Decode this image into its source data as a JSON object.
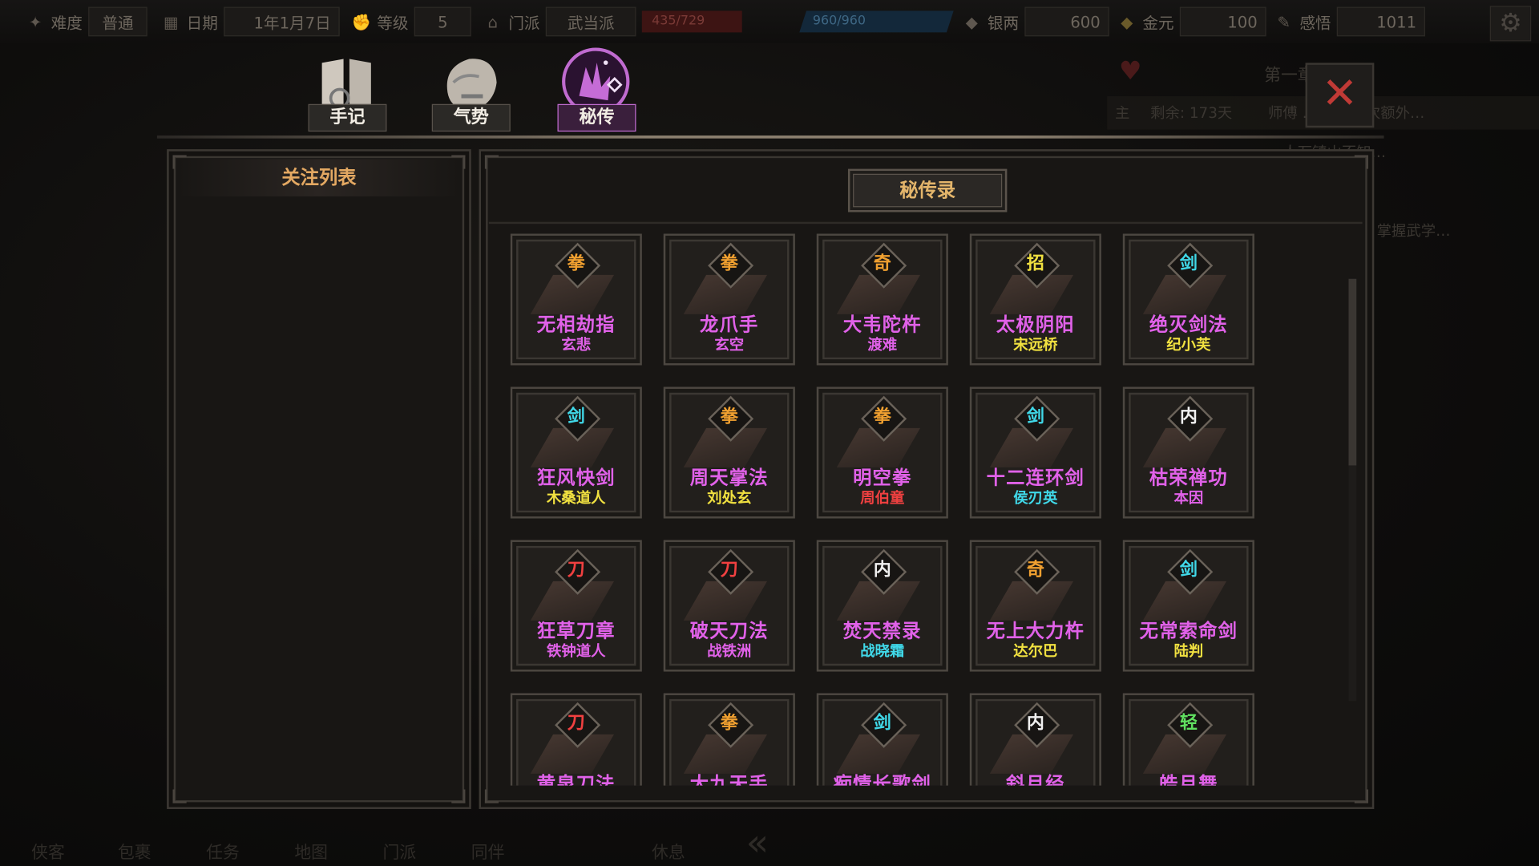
{
  "topbar": {
    "difficulty_label": "难度",
    "difficulty_value": "普通",
    "date_label": "日期",
    "date_value": "1年1月7日",
    "level_label": "等级",
    "level_value": "5",
    "sect_label": "门派",
    "sect_value": "武当派",
    "hp": "435/729",
    "mp": "960/960",
    "silver_label": "银两",
    "silver_value": "600",
    "gold_label": "金元",
    "gold_value": "100",
    "insight_label": "感悟",
    "insight_value": "1011"
  },
  "quest": {
    "title": "第一章 … 学艺",
    "rows": [
      {
        "tag": "主",
        "text": "剩余: 173天",
        "detail": "师傅 … 让力一次额外…"
      },
      {
        "tag": "",
        "text": "",
        "detail": "…人万镇山不知…"
      },
      {
        "tag": "",
        "text": "",
        "detail": "…"
      },
      {
        "tag": "",
        "text": "",
        "detail": "…籍 掌握武学…"
      }
    ]
  },
  "tabs": [
    {
      "label": "手记",
      "icon": "book-icon"
    },
    {
      "label": "气势",
      "icon": "lion-icon"
    },
    {
      "label": "秘传",
      "icon": "hand-icon"
    }
  ],
  "left_panel": {
    "title": "关注列表"
  },
  "right_panel": {
    "title": "秘传录"
  },
  "colors": {
    "purple": "#e061e8",
    "orange": "#f0a030",
    "yellow": "#f0e040",
    "cyan": "#40d8e8",
    "red": "#f04040",
    "white": "#f0f0f0",
    "green": "#60e060"
  },
  "cards": [
    {
      "type": "拳",
      "type_color": "#f0a030",
      "name": "无相劫指",
      "master": "玄悲",
      "master_color": "#e061e8"
    },
    {
      "type": "拳",
      "type_color": "#f0a030",
      "name": "龙爪手",
      "master": "玄空",
      "master_color": "#e061e8"
    },
    {
      "type": "奇",
      "type_color": "#f0a030",
      "name": "大韦陀杵",
      "master": "渡难",
      "master_color": "#e061e8"
    },
    {
      "type": "招",
      "type_color": "#f0e040",
      "name": "太极阴阳",
      "master": "宋远桥",
      "master_color": "#f0e040"
    },
    {
      "type": "剑",
      "type_color": "#40d8e8",
      "name": "绝灭剑法",
      "master": "纪小芙",
      "master_color": "#f0e040"
    },
    {
      "type": "剑",
      "type_color": "#40d8e8",
      "name": "狂风快剑",
      "master": "木桑道人",
      "master_color": "#f0e040"
    },
    {
      "type": "拳",
      "type_color": "#f0a030",
      "name": "周天掌法",
      "master": "刘处玄",
      "master_color": "#f0e040"
    },
    {
      "type": "拳",
      "type_color": "#f0a030",
      "name": "明空拳",
      "master": "周伯童",
      "master_color": "#f04040"
    },
    {
      "type": "剑",
      "type_color": "#40d8e8",
      "name": "十二连环剑",
      "master": "侯刃英",
      "master_color": "#40d8e8"
    },
    {
      "type": "内",
      "type_color": "#f0f0f0",
      "name": "枯荣禅功",
      "master": "本因",
      "master_color": "#e061e8"
    },
    {
      "type": "刀",
      "type_color": "#f04040",
      "name": "狂草刀章",
      "master": "铁钟道人",
      "master_color": "#e061e8"
    },
    {
      "type": "刀",
      "type_color": "#f04040",
      "name": "破天刀法",
      "master": "战铁洲",
      "master_color": "#e061e8"
    },
    {
      "type": "内",
      "type_color": "#f0f0f0",
      "name": "焚天禁录",
      "master": "战晓霜",
      "master_color": "#40d8e8"
    },
    {
      "type": "奇",
      "type_color": "#f0a030",
      "name": "无上大力杵",
      "master": "达尔巴",
      "master_color": "#f0e040"
    },
    {
      "type": "剑",
      "type_color": "#40d8e8",
      "name": "无常索命剑",
      "master": "陆判",
      "master_color": "#f0e040"
    },
    {
      "type": "刀",
      "type_color": "#f04040",
      "name": "黄泉刀法",
      "master": "",
      "master_color": "#e061e8"
    },
    {
      "type": "拳",
      "type_color": "#f0a030",
      "name": "大九天手",
      "master": "",
      "master_color": "#e061e8"
    },
    {
      "type": "剑",
      "type_color": "#40d8e8",
      "name": "痴情长歌剑",
      "master": "",
      "master_color": "#e061e8"
    },
    {
      "type": "内",
      "type_color": "#f0f0f0",
      "name": "斜月经",
      "master": "",
      "master_color": "#e061e8"
    },
    {
      "type": "轻",
      "type_color": "#60e060",
      "name": "皓月舞",
      "master": "",
      "master_color": "#e061e8"
    }
  ],
  "bottom_nav": [
    "侠客",
    "包裹",
    "任务",
    "地图",
    "门派",
    "同伴",
    "休息"
  ]
}
